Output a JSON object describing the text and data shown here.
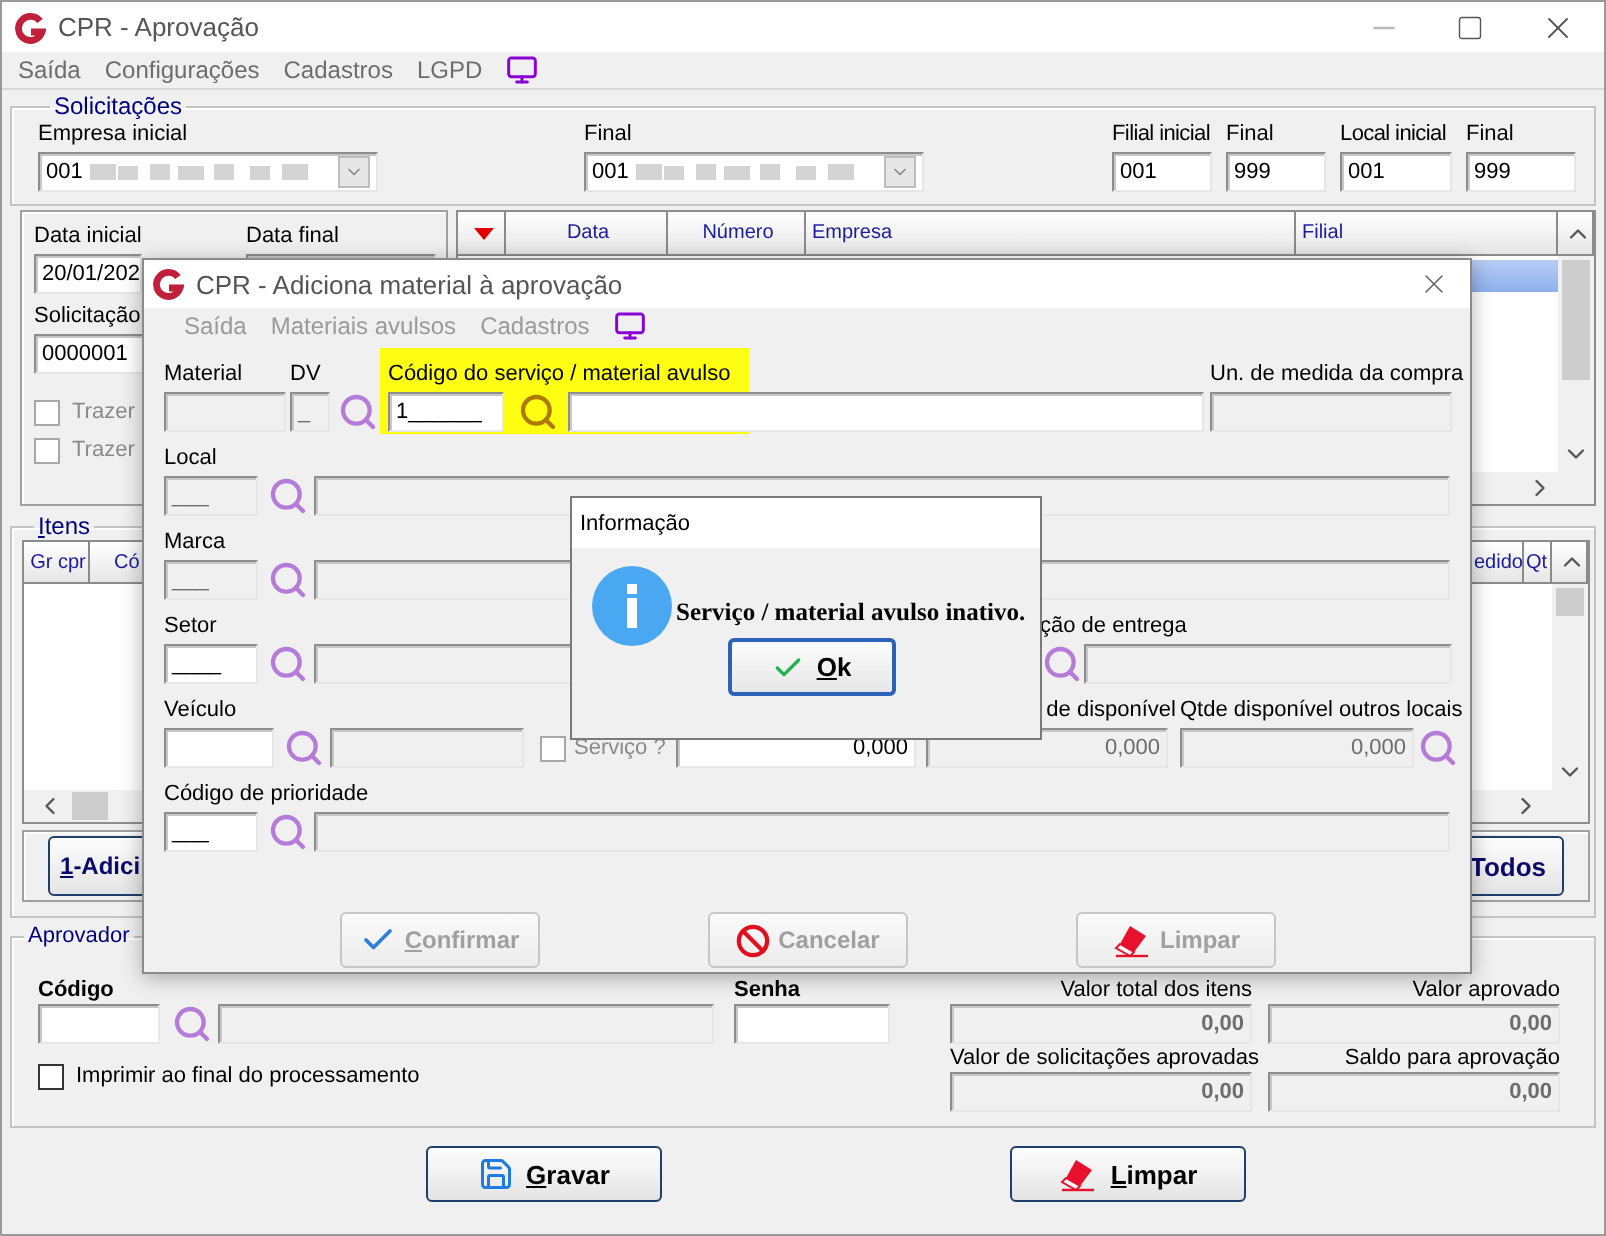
{
  "window": {
    "title": "CPR - Aprovação"
  },
  "menu": [
    {
      "label": "Saída"
    },
    {
      "label": "Configurações"
    },
    {
      "label": "Cadastros"
    },
    {
      "label": "LGPD"
    }
  ],
  "solicitacoes": {
    "title": "Solicitações",
    "empresa_inicial": {
      "label": "Empresa inicial",
      "value": "001"
    },
    "empresa_final": {
      "label": "Final",
      "value": "001"
    },
    "filial_inicial": {
      "label": "Filial inicial",
      "value": "001"
    },
    "filial_final": {
      "label": "Final",
      "value": "999"
    },
    "local_inicial": {
      "label": "Local inicial",
      "value": "001"
    },
    "local_final": {
      "label": "Final",
      "value": "999"
    }
  },
  "filtros": {
    "data_inicial": {
      "label": "Data inicial",
      "value": "20/01/202"
    },
    "data_final": {
      "label": "Data final"
    },
    "solicitacao": {
      "label": "Solicitação",
      "value": "0000001"
    },
    "options": [
      {
        "label": "Trazer",
        "checked": false
      },
      {
        "label": "Trazer",
        "checked": false
      }
    ]
  },
  "solicitacoes_grid": {
    "columns": [
      "Data",
      "Número",
      "Empresa",
      "Filial"
    ],
    "rows": [
      {
        "selected": true
      }
    ]
  },
  "itens": {
    "title": "Itens",
    "columns": [
      "Gr cpr",
      "Có",
      "edido",
      "Qt"
    ],
    "add_button": "1-Adici",
    "all_button": "Todos"
  },
  "aprovador": {
    "title": "Aprovador",
    "codigo_label": "Código",
    "senha_label": "Senha",
    "print_option": {
      "label": "Imprimir ao final do processamento",
      "checked": false
    },
    "totals": [
      {
        "label": "Valor total dos itens",
        "value": "0,00"
      },
      {
        "label": "Valor aprovado",
        "value": "0,00"
      },
      {
        "label": "Valor de solicitações aprovadas",
        "value": "0,00"
      },
      {
        "label": "Saldo para aprovação",
        "value": "0,00"
      }
    ]
  },
  "actions": [
    {
      "label": "Gravar",
      "kind": "save"
    },
    {
      "label": "Limpar",
      "kind": "clear"
    }
  ],
  "dialog": {
    "title": "CPR - Adiciona material à aprovação",
    "menu": [
      {
        "label": "Saída"
      },
      {
        "label": "Materiais avulsos"
      },
      {
        "label": "Cadastros"
      }
    ],
    "material": {
      "label": "Material"
    },
    "dv": {
      "label": "DV",
      "value": "_"
    },
    "codigo": {
      "label": "Código do serviço / material avulso",
      "value": "1______",
      "highlighted": true
    },
    "unidade": {
      "label": "Un. de medida da compra"
    },
    "local": {
      "label": "Local",
      "value": "___"
    },
    "marca": {
      "label": "Marca",
      "value": "___"
    },
    "setor": {
      "label": "Setor",
      "value": "____"
    },
    "entrega": {
      "label": "ção de entrega"
    },
    "veiculo": {
      "label": "Veículo"
    },
    "servico": {
      "label": "Serviço ?",
      "checked": false
    },
    "quantidade": {
      "value": "0,000"
    },
    "disponivel": {
      "label": "de disponível",
      "value": "0,000"
    },
    "outros": {
      "label": "Qtde disponível outros locais",
      "value": "0,000"
    },
    "prioridade": {
      "label": "Código de prioridade",
      "value": "___"
    },
    "buttons": [
      {
        "label": "Confirmar",
        "kind": "confirm",
        "disabled": true
      },
      {
        "label": "Cancelar",
        "kind": "cancel",
        "disabled": true
      },
      {
        "label": "Limpar",
        "kind": "clear",
        "disabled": true
      }
    ]
  },
  "info": {
    "title": "Informação",
    "message": "Serviço / material avulso inativo.",
    "button": "Ok"
  }
}
